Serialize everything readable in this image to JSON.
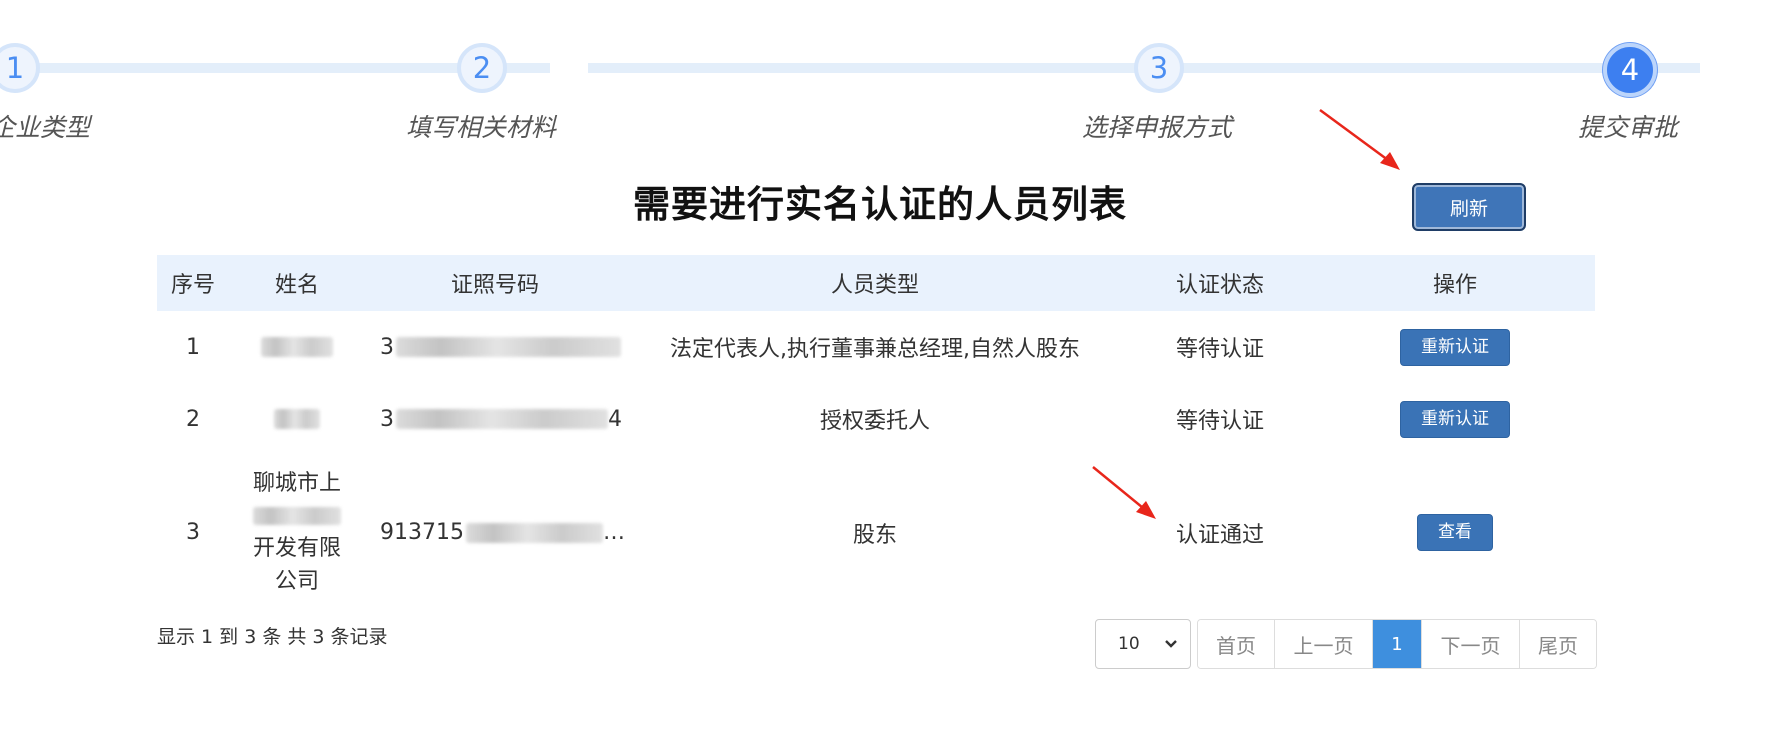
{
  "stepper": {
    "steps": [
      {
        "number": "1",
        "label": "企业类型"
      },
      {
        "number": "2",
        "label": "填写相关材料"
      },
      {
        "number": "3",
        "label": "选择申报方式"
      },
      {
        "number": "4",
        "label": "提交审批"
      }
    ],
    "active_step": 4
  },
  "title": "需要进行实名认证的人员列表",
  "refresh_label": "刷新",
  "table": {
    "headers": [
      "序号",
      "姓名",
      "证照号码",
      "人员类型",
      "认证状态",
      "操作"
    ],
    "rows": [
      {
        "index": "1",
        "name": "",
        "id_number": "3",
        "person_type": "法定代表人,执行董事兼总经理,自然人股东",
        "status": "等待认证",
        "action": "重新认证"
      },
      {
        "index": "2",
        "name": "",
        "id_number": "3",
        "id_suffix": "4",
        "person_type": "授权委托人",
        "status": "等待认证",
        "action": "重新认证"
      },
      {
        "index": "3",
        "name_lines": [
          "聊城市上",
          "开发有限",
          "公司"
        ],
        "id_number": "913715",
        "id_ellipsis": "…",
        "person_type": "股东",
        "status": "认证通过",
        "action": "查看"
      }
    ]
  },
  "footer": {
    "summary": "显示 1 到 3 条 共 3 条记录",
    "page_size": "10",
    "pagination": {
      "first": "首页",
      "prev": "上一页",
      "current": "1",
      "next": "下一页",
      "last": "尾页"
    }
  },
  "colors": {
    "primary_button": "#3a73b6",
    "active_page": "#3e8fde",
    "header_bg": "#e9f2fd",
    "arrow": "#e8261b"
  },
  "icons": {
    "dropdown": "chevron-down-icon",
    "annotation": "red-arrow-icon"
  }
}
